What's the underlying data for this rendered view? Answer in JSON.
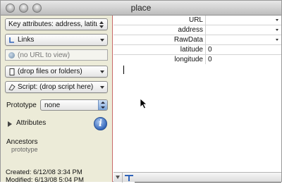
{
  "window": {
    "title": "place"
  },
  "sidebar": {
    "key_attributes": "Key attributes: address, latitud...",
    "links": "Links",
    "url_placeholder": "(no URL to view)",
    "file_drop": "(drop files or folders)",
    "script_drop": "Script: (drop script here)",
    "prototype_label": "Prototype",
    "prototype_value": "none",
    "attributes_label": "Attributes",
    "ancestors_label": "Ancestors",
    "ancestors_value": "prototype",
    "created": "Created: 6/12/08 3:34 PM",
    "modified": "Modified: 6/13/08 5:04 PM"
  },
  "attributes": [
    {
      "key": "URL",
      "value": "",
      "has_dropdown": true
    },
    {
      "key": "address",
      "value": "",
      "has_dropdown": true
    },
    {
      "key": "RawData",
      "value": "",
      "has_dropdown": true
    },
    {
      "key": "latitude",
      "value": "0",
      "has_dropdown": false
    },
    {
      "key": "longitude",
      "value": "0",
      "has_dropdown": false
    }
  ],
  "colors": {
    "sidebar_bg": "#ecebd8",
    "divider": "#c96a6a",
    "info_blue": "#2f63b8"
  },
  "icons": [
    "link-icon",
    "globe-icon",
    "file-icon",
    "script-icon",
    "info-icon",
    "tab-stop-icon",
    "arrow-cursor-icon"
  ]
}
